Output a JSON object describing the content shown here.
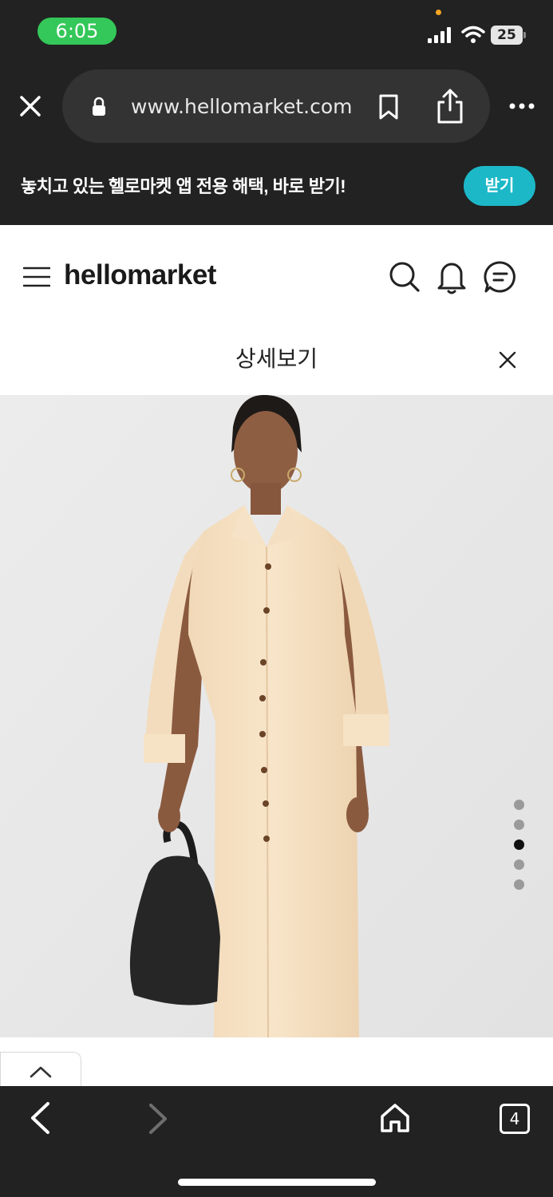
{
  "status_bar": {
    "time": "6:05",
    "battery": "25",
    "icons": [
      "signal-icon",
      "wifi-icon",
      "battery-icon"
    ],
    "time_pill_color": "#34c759"
  },
  "browser": {
    "url": "www.hellomarket.com",
    "icons": [
      "close-icon",
      "lock-icon",
      "bookmark-icon",
      "share-icon",
      "more-icon"
    ]
  },
  "promo_banner": {
    "text": "놓치고 있는 헬로마켓 앱 전용 해택, 바로 받기!",
    "button_label": "받기",
    "button_color": "#1cb8c8"
  },
  "app_header": {
    "logo": "hellomarket",
    "icons": [
      "menu-icon",
      "search-icon",
      "bell-icon",
      "chat-icon"
    ]
  },
  "detail": {
    "title": "상세보기",
    "close_icon": "close-icon",
    "image_alt": "shirt dress product photo",
    "carousel": {
      "count": 5,
      "active_index": 3
    }
  },
  "bottom_nav": {
    "tab_count": "4",
    "icons": [
      "back-arrow-icon",
      "forward-arrow-icon",
      "home-icon",
      "tabs-icon"
    ]
  }
}
